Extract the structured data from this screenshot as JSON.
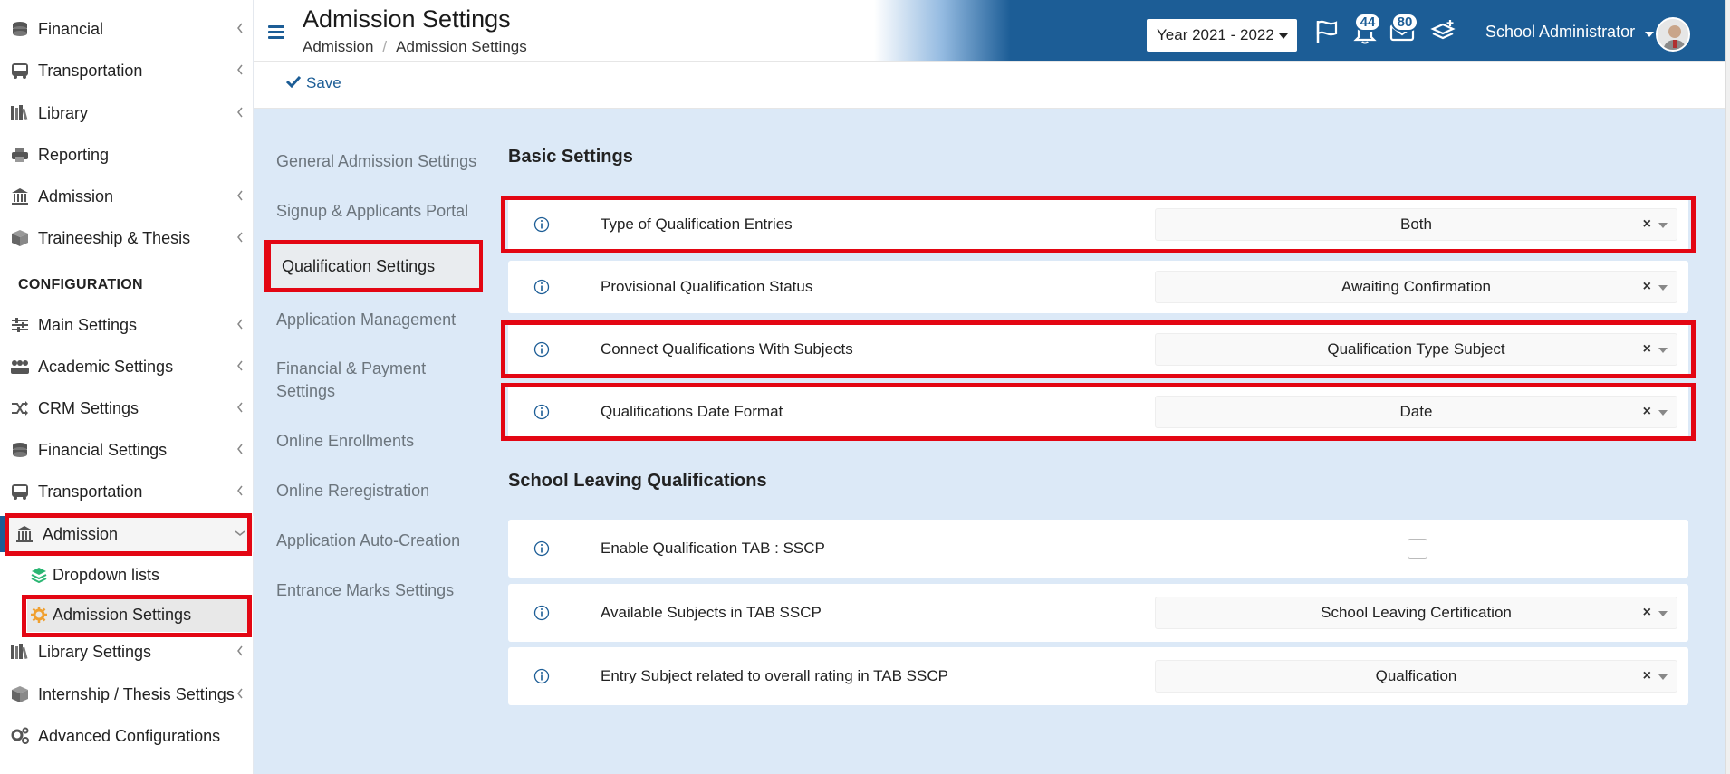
{
  "sidebar": {
    "items_top": [
      {
        "label": "Financial",
        "icon": "coins-icon"
      },
      {
        "label": "Transportation",
        "icon": "bus-icon"
      },
      {
        "label": "Library",
        "icon": "books-icon"
      },
      {
        "label": "Reporting",
        "icon": "printer-icon"
      },
      {
        "label": "Admission",
        "icon": "institution-icon"
      },
      {
        "label": "Traineeship & Thesis",
        "icon": "box-icon"
      }
    ],
    "config_heading": "CONFIGURATION",
    "items_config": [
      {
        "label": "Main Settings",
        "icon": "sliders-icon"
      },
      {
        "label": "Academic Settings",
        "icon": "users-icon"
      },
      {
        "label": "CRM Settings",
        "icon": "shuffle-icon"
      },
      {
        "label": "Financial Settings",
        "icon": "coins-icon"
      },
      {
        "label": "Transportation",
        "icon": "bus-icon"
      },
      {
        "label": "Admission",
        "icon": "institution-icon"
      }
    ],
    "sub_items": [
      {
        "label": "Dropdown lists",
        "icon": "layers-icon"
      },
      {
        "label": "Admission Settings",
        "icon": "gear-icon"
      }
    ],
    "items_bottom": [
      {
        "label": "Library Settings",
        "icon": "books-icon"
      },
      {
        "label": "Internship / Thesis Settings",
        "icon": "box-icon"
      },
      {
        "label": "Advanced Configurations",
        "icon": "gears-icon"
      }
    ]
  },
  "header": {
    "title": "Admission Settings",
    "breadcrumb": [
      "Admission",
      "Admission Settings"
    ],
    "breadcrumb_sep": "/",
    "year": "Year 2021 - 2022",
    "notifications_count": "44",
    "messages_count": "80",
    "user_name": "School Administrator"
  },
  "toolbar": {
    "save_label": "Save"
  },
  "tabs": [
    "General Admission Settings",
    "Signup & Applicants Portal",
    "Qualification Settings",
    "Application Management",
    "Financial & Payment Settings",
    "Online Enrollments",
    "Online Reregistration",
    "Application Auto-Creation",
    "Entrance Marks Settings"
  ],
  "active_tab": "Qualification Settings",
  "basic": {
    "title": "Basic Settings",
    "rows": [
      {
        "label": "Type of Qualification Entries",
        "value": "Both"
      },
      {
        "label": "Provisional Qualification Status",
        "value": "Awaiting Confirmation"
      },
      {
        "label": "Connect Qualifications With Subjects",
        "value": "Qualification Type Subject"
      },
      {
        "label": "Qualifications Date Format",
        "value": "Date"
      }
    ]
  },
  "school": {
    "title": "School Leaving Qualifications",
    "rows": [
      {
        "label": "Enable Qualification TAB : SSCP",
        "checked": false
      },
      {
        "label": "Available Subjects in TAB SSCP",
        "value": "School Leaving Certification"
      },
      {
        "label": "Entry Subject related to overall rating in TAB SSCP",
        "value": "Qualfication"
      }
    ]
  },
  "clear_symbol": "×",
  "colors": {
    "brand": "#1c5d96",
    "highlight": "#e30613",
    "content_bg": "#dce9f7"
  }
}
